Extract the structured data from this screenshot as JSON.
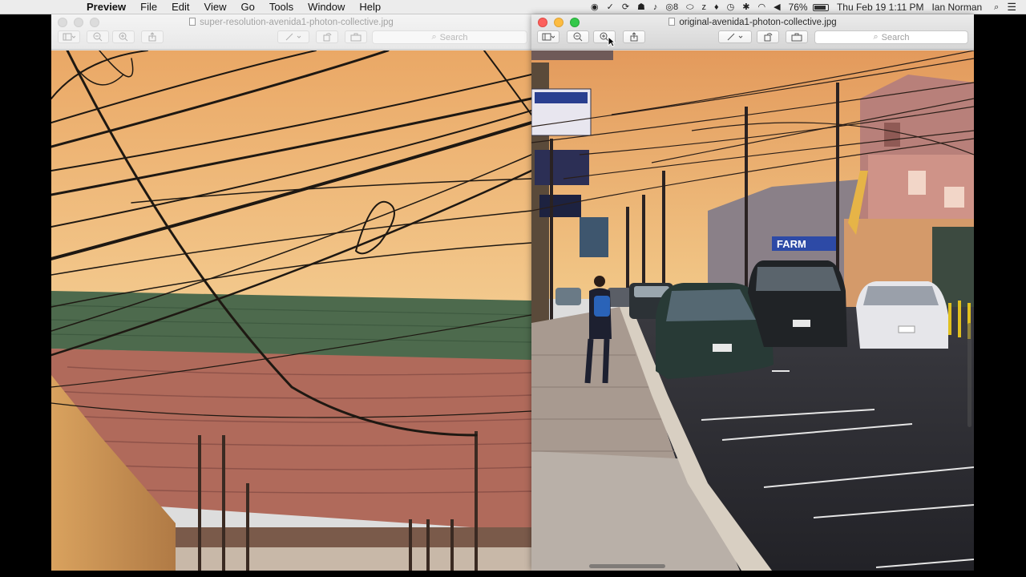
{
  "menubar": {
    "app_name": "Preview",
    "items": [
      "File",
      "Edit",
      "View",
      "Go",
      "Tools",
      "Window",
      "Help"
    ],
    "status": {
      "badge_count": "8",
      "battery_percent": "76%",
      "clock": "Thu Feb 19  1:11 PM",
      "user": "Ian Norman"
    }
  },
  "left_window": {
    "title": "super-resolution-avenida1-photon-collective.jpg",
    "search_placeholder": "Search",
    "state": "inactive"
  },
  "right_window": {
    "title": "original-avenida1-photon-collective.jpg",
    "search_placeholder": "Search",
    "state": "active",
    "sign_text": "FARM"
  },
  "colors": {
    "sky_top": "#e8a260",
    "sky_bottom": "#f2c686",
    "roof_green": "#4d6a4d",
    "roof_red": "#b06a5b",
    "road": "#2b2b30",
    "traffic_close": "#fc605c",
    "traffic_min": "#fdbc40",
    "traffic_max": "#34c84a"
  },
  "icons": [
    "apple-icon",
    "sidebar-icon",
    "zoom-out-icon",
    "zoom-in-icon",
    "share-icon",
    "markup-pen-icon",
    "rotate-icon",
    "toolbox-icon",
    "search-icon",
    "battery-icon",
    "wifi-icon",
    "bluetooth-icon",
    "volume-icon",
    "spotlight-icon",
    "notification-list-icon"
  ]
}
